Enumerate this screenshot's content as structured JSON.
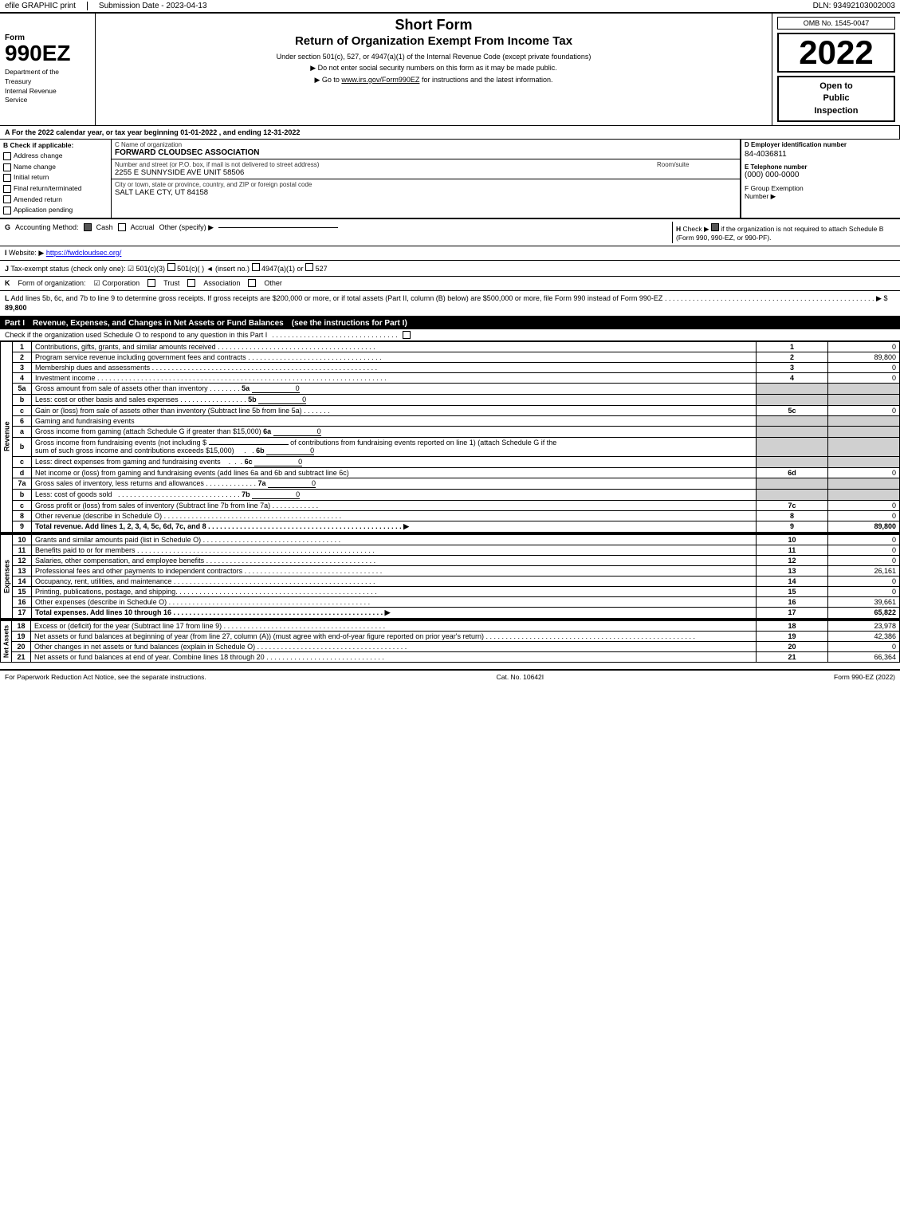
{
  "header": {
    "efile_label": "efile GRAPHIC print",
    "submission_date_label": "Submission Date - 2023-04-13",
    "dln_label": "DLN: 93492103002003",
    "form_number": "990EZ",
    "dept_line1": "Department of the",
    "dept_line2": "Treasury",
    "dept_line3": "Internal Revenue",
    "dept_line4": "Service",
    "short_form": "Short Form",
    "return_title": "Return of Organization Exempt From Income Tax",
    "sub1": "Under section 501(c), 527, or 4947(a)(1) of the Internal Revenue Code (except private foundations)",
    "sub2": "▶ Do not enter social security numbers on this form as it may be made public.",
    "sub3": "▶ Go to",
    "sub3_link": "www.irs.gov/Form990EZ",
    "sub3_rest": "for instructions and the latest information.",
    "omb": "OMB No. 1545-0047",
    "year": "2022",
    "open_inspection_line1": "Open to",
    "open_inspection_line2": "Public",
    "open_inspection_line3": "Inspection"
  },
  "section_a": {
    "label": "A",
    "text": "For the 2022 calendar year, or tax year beginning 01-01-2022 , and ending 12-31-2022"
  },
  "section_b": {
    "label": "B",
    "check_label": "Check if applicable:",
    "items": [
      "Address change",
      "Name change",
      "Initial return",
      "Final return/terminated",
      "Amended return",
      "Application pending"
    ]
  },
  "org": {
    "c_label": "C Name of organization",
    "name": "FORWARD CLOUDSEC ASSOCIATION",
    "address_label": "Number and street (or P.O. box, if mail is not delivered to street address)",
    "address": "2255 E SUNNYSIDE AVE UNIT 58506",
    "room_label": "Room/suite",
    "room": "",
    "city_label": "City or town, state or province, country, and ZIP or foreign postal code",
    "city": "SALT LAKE CTY, UT  84158",
    "d_label": "D Employer identification number",
    "ein": "84-4036811",
    "e_label": "E Telephone number",
    "phone": "(000) 000-0000",
    "f_label": "F Group Exemption",
    "f_label2": "Number",
    "f_arrow": "▶"
  },
  "section_g": {
    "label": "G",
    "text": "Accounting Method:",
    "cash_check": true,
    "cash_label": "Cash",
    "accrual_check": false,
    "accrual_label": "Accrual",
    "other_label": "Other (specify) ▶",
    "other_line": "____________________________",
    "h_label": "H",
    "h_check_label": "Check ▶",
    "h_check": true,
    "h_text": "if the organization is not required to attach Schedule B (Form 990, 990-EZ, or 990-PF)."
  },
  "section_i": {
    "label": "I",
    "text": "Website: ▶",
    "url": "https://fwdcloudsec.org/"
  },
  "section_j": {
    "label": "J",
    "text": "Tax-exempt status",
    "check_label": "(check only one):",
    "options": [
      "✔ 501(c)(3)",
      "○ 501(c)(",
      "  ) ◄ (insert no.)",
      "○ 4947(a)(1) or",
      "○ 527"
    ]
  },
  "section_k": {
    "label": "K",
    "text": "Form of organization:",
    "options": [
      "✔ Corporation",
      "○ Trust",
      "○ Association",
      "○ Other"
    ]
  },
  "section_l": {
    "label": "L",
    "text": "Add lines 5b, 6c, and 7b to line 9 to determine gross receipts. If gross receipts are $200,000 or more, or if total assets (Part II, column (B) below) are $500,000 or more, file Form 990 instead of Form 990-EZ",
    "dots": ". . . . . . . . . . . . . . . . . . . . . . . . . . . . . . . . . . . . . . . . . . . . . . . . . . . . .",
    "arrow": "▶ $",
    "value": "89,800"
  },
  "part1": {
    "label": "Part I",
    "title": "Revenue, Expenses, and Changes in Net Assets or Fund Balances",
    "see_instructions": "(see the instructions for Part I)",
    "check_text": "Check if the organization used Schedule O to respond to any question in this Part I",
    "check_dots": ". . . . . . . . . . . . . . . . . . . . . . . . . . . . . . . .",
    "check_box": "□",
    "lines": [
      {
        "num": "1",
        "desc": "Contributions, gifts, grants, and similar amounts received",
        "dots": ". . . . . . . . . . . . . . . . . . . . . . . . . . . . . . . . . . . . . . .",
        "line_ref": "1",
        "value": "0"
      },
      {
        "num": "2",
        "desc": "Program service revenue including government fees and contracts",
        "dots": ". . . . . . . . . . . . . . . . . . . . . . . . . . . . . . . . .",
        "line_ref": "2",
        "value": "89,800"
      },
      {
        "num": "3",
        "desc": "Membership dues and assessments",
        "dots": ". . . . . . . . . . . . . . . . . . . . . . . . . . . . . . . . . . . . . . . . . . . . . . . . . . . . . . . . .",
        "line_ref": "3",
        "value": "0"
      },
      {
        "num": "4",
        "desc": "Investment income",
        "dots": ". . . . . . . . . . . . . . . . . . . . . . . . . . . . . . . . . . . . . . . . . . . . . . . . . . . . . . . . . . . . . . . . . . . . . . . . .",
        "line_ref": "4",
        "value": "0"
      }
    ],
    "line5a": {
      "num": "5a",
      "desc": "Gross amount from sale of assets other than inventory",
      "dots": ". . . . . . . .",
      "inner_ref": "5a",
      "inner_val": "0"
    },
    "line5b": {
      "num": "b",
      "desc": "Less: cost or other basis and sales expenses",
      "dots": ". . . . . . . . . . . . . . . . .",
      "inner_ref": "5b",
      "inner_val": "0"
    },
    "line5c": {
      "num": "c",
      "desc": "Gain or (loss) from sale of assets other than inventory (Subtract line 5b from line 5a)",
      "dots": ". . . . . . .",
      "line_ref": "5c",
      "value": "0"
    },
    "line6": {
      "num": "6",
      "desc": "Gaming and fundraising events"
    },
    "line6a": {
      "num": "a",
      "desc": "Gross income from gaming (attach Schedule G if greater than $15,000)",
      "inner_ref": "6a",
      "inner_val": "0"
    },
    "line6b_text": "Gross income from fundraising events (not including $",
    "line6b_blank": "________________",
    "line6b_rest": "of contributions from fundraising events reported on line 1) (attach Schedule G if the sum of such gross income and contributions exceeds $15,000)",
    "line6b": {
      "num": "b",
      "dots": "   .   .",
      "inner_ref": "6b",
      "inner_val": "0"
    },
    "line6c": {
      "num": "c",
      "desc": "Less: direct expenses from gaming and fundraising events",
      "dots": "   .   .   .",
      "inner_ref": "6c",
      "inner_val": "0"
    },
    "line6d": {
      "num": "d",
      "desc": "Net income or (loss) from gaming and fundraising events (add lines 6a and 6b and subtract line 6c)",
      "line_ref": "6d",
      "value": "0"
    },
    "line7a": {
      "num": "7a",
      "desc": "Gross sales of inventory, less returns and allowances",
      "dots": ". . . . . . . . . . . .",
      "inner_ref": "7a",
      "inner_val": "0"
    },
    "line7b": {
      "num": "b",
      "desc": "Less: cost of goods sold",
      "dots": ". . . . . . . . . . . . . . . . . . . . . . . . . . . . . . . .",
      "inner_ref": "7b",
      "inner_val": "0"
    },
    "line7c": {
      "num": "c",
      "desc": "Gross profit or (loss) from sales of inventory (Subtract line 7b from line 7a)",
      "dots": ". . . . . . . . . . . .",
      "line_ref": "7c",
      "value": "0"
    },
    "line8": {
      "num": "8",
      "desc": "Other revenue (describe in Schedule O)",
      "dots": ". . . . . . . . . . . . . . . . . . . . . . . . . . . . . . . . . . . . . . . . . . . . .",
      "line_ref": "8",
      "value": "0"
    },
    "line9": {
      "num": "9",
      "desc": "Total revenue. Add lines 1, 2, 3, 4, 5c, 6d, 7c, and 8",
      "dots": ". . . . . . . . . . . . . . . . . . . . . . . . . . . . . . . . . . . . . . . . . . . . . . . .",
      "arrow": "▶",
      "line_ref": "9",
      "value": "89,800"
    }
  },
  "expenses": {
    "lines": [
      {
        "num": "10",
        "desc": "Grants and similar amounts paid (list in Schedule O)",
        "dots": ". . . . . . . . . . . . . . . . . . . . . . . . . . . . . . . . . . .",
        "line_ref": "10",
        "value": "0"
      },
      {
        "num": "11",
        "desc": "Benefits paid to or for members",
        "dots": ". . . . . . . . . . . . . . . . . . . . . . . . . . . . . . . . . . . . . . . . . . . . . . . . . . . . . . . . . . . .",
        "line_ref": "11",
        "value": "0"
      },
      {
        "num": "12",
        "desc": "Salaries, other compensation, and employee benefits",
        "dots": ". . . . . . . . . . . . . . . . . . . . . . . . . . . . . . . . . . . . . . . . . . .",
        "line_ref": "12",
        "value": "0"
      },
      {
        "num": "13",
        "desc": "Professional fees and other payments to independent contractors",
        "dots": ". . . . . . . . . . . . . . . . . . . . . . . . . . . . . . . . . . . . . .",
        "line_ref": "13",
        "value": "26,161"
      },
      {
        "num": "14",
        "desc": "Occupancy, rent, utilities, and maintenance",
        "dots": ". . . . . . . . . . . . . . . . . . . . . . . . . . . . . . . . . . . . . . . . . . . . . . . . . . . . .",
        "line_ref": "14",
        "value": "0"
      },
      {
        "num": "15",
        "desc": "Printing, publications, postage, and shipping",
        "dots": ". . . . . . . . . . . . . . . . . . . . . . . . . . . . . . . . . . . . . . . . . . . . . . . . . . .",
        "line_ref": "15",
        "value": "0"
      },
      {
        "num": "16",
        "desc": "Other expenses (describe in Schedule O)",
        "dots": ". . . . . . . . . . . . . . . . . . . . . . . . . . . . . . . . . . . . . . . . . . . . . . . . . .",
        "line_ref": "16",
        "value": "39,661"
      },
      {
        "num": "17",
        "desc": "Total expenses. Add lines 10 through 16",
        "dots": ". . . . . . . . . . . . . . . . . . . . . . . . . . . . . . . . . . . . . . . . . . . . . . . . . . . . . .",
        "arrow": "▶",
        "line_ref": "17",
        "value": "65,822"
      }
    ]
  },
  "net_assets": {
    "lines": [
      {
        "num": "18",
        "desc": "Excess or (deficit) for the year (Subtract line 17 from line 9)",
        "dots": ". . . . . . . . . . . . . . . . . . . . . . . . . . . . . . . . . . . . . . . . . .",
        "line_ref": "18",
        "value": "23,978"
      },
      {
        "num": "19",
        "desc": "Net assets or fund balances at beginning of year (from line 27, column (A)) (must agree with end-of-year figure reported on prior year's return)",
        "dots": ". . . . . . . . . . . . . . . . . . . . . . . . . . . . . . . . . . . . . . . . . . . . . . . . . . . . . .",
        "line_ref": "19",
        "value": "42,386"
      },
      {
        "num": "20",
        "desc": "Other changes in net assets or fund balances (explain in Schedule O)",
        "dots": ". . . . . . . . . . . . . . . . . . . . . . . . . . . . . . . . . . . . . . . . . . . . .",
        "line_ref": "20",
        "value": "0"
      },
      {
        "num": "21",
        "desc": "Net assets or fund balances at end of year. Combine lines 18 through 20",
        "dots": ". . . . . . . . . . . . . . . . . . . . . . . . . . . . . . . .",
        "line_ref": "21",
        "value": "66,364"
      }
    ]
  },
  "footer": {
    "paperwork_text": "For Paperwork Reduction Act Notice, see the separate instructions.",
    "cat_no": "Cat. No. 10642I",
    "form_ref": "Form 990-EZ (2022)"
  },
  "revenue_side_label": "Revenue",
  "expenses_side_label": "Expenses",
  "net_assets_side_label": "Net Assets"
}
